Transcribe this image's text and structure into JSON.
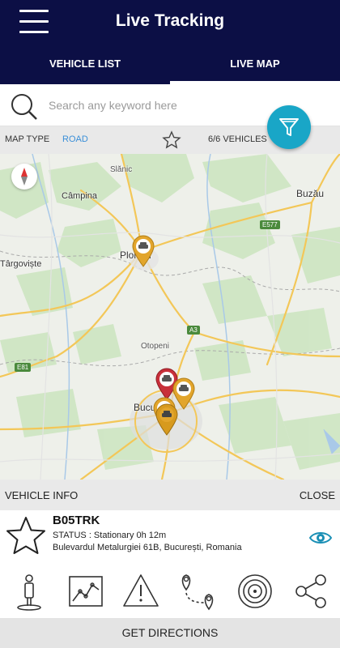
{
  "header": {
    "title": "Live Tracking",
    "tabs": [
      {
        "label": "VEHICLE LIST",
        "active": false
      },
      {
        "label": "LIVE MAP",
        "active": true
      }
    ]
  },
  "search": {
    "placeholder": "Search any keyword here",
    "value": ""
  },
  "map_bar": {
    "map_type_label": "MAP TYPE",
    "map_type_value": "ROAD",
    "vehicles": "6/6 VEHICLES"
  },
  "map": {
    "cities": [
      "Slănic",
      "Câmpina",
      "Buzău",
      "Târgoviște",
      "Ploiești",
      "Otopeni",
      "București"
    ],
    "road_labels": [
      "E577",
      "A3",
      "E81"
    ],
    "markers": [
      {
        "name": "vehicle-marker-ploiesti",
        "color": "#e2a52c"
      },
      {
        "name": "vehicle-marker-otopeni-red",
        "color": "#c8303a"
      },
      {
        "name": "vehicle-marker-bucuresti-1",
        "color": "#e2a52c"
      },
      {
        "name": "vehicle-marker-bucuresti-2",
        "color": "#e2a52c"
      },
      {
        "name": "vehicle-marker-bucuresti-3",
        "color": "#e2a52c"
      }
    ]
  },
  "vehicle_info": {
    "label": "VEHICLE INFO",
    "close": "CLOSE",
    "name": "B05TRK",
    "status": "STATUS : Stationary 0h 12m",
    "address": "Bulevardul Metalurgiei 61B, București, Romania"
  },
  "actions": [
    "driver-icon",
    "chart-icon",
    "alert-icon",
    "route-icon",
    "geofence-icon",
    "share-icon"
  ],
  "directions": {
    "label": "GET DIRECTIONS"
  },
  "colors": {
    "header_bg": "#0c0f45",
    "accent": "#19a6c7",
    "link": "#3a8fd8",
    "marker_yellow": "#e2a52c",
    "marker_red": "#c8303a"
  }
}
